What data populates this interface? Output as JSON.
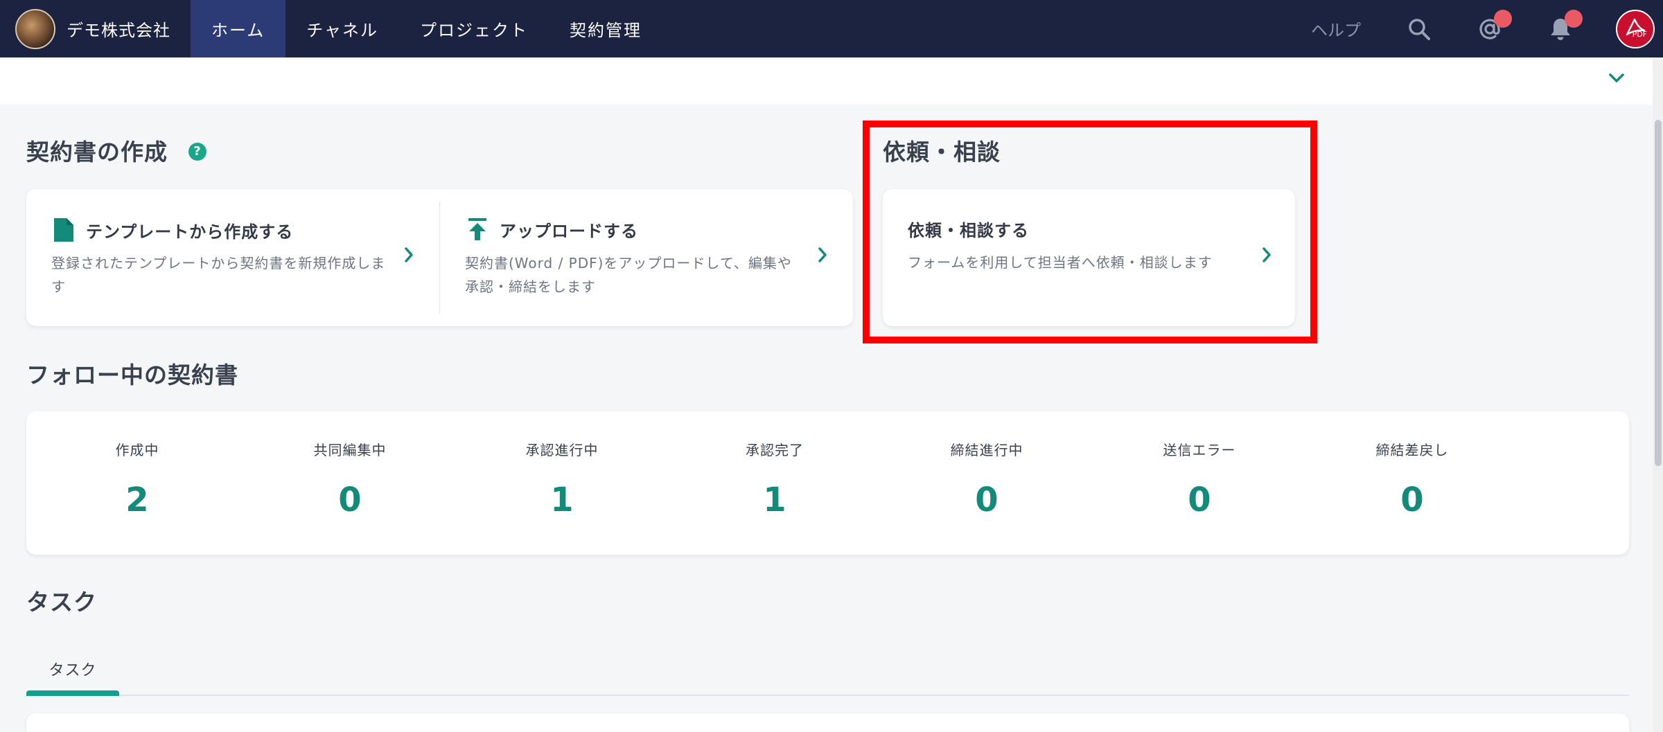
{
  "nav": {
    "company": "デモ株式会社",
    "tabs": [
      {
        "label": "ホーム",
        "active": true
      },
      {
        "label": "チャネル",
        "active": false
      },
      {
        "label": "プロジェクト",
        "active": false
      },
      {
        "label": "契約管理",
        "active": false
      }
    ],
    "help": "ヘルプ",
    "pdf_label": "PDF"
  },
  "create": {
    "title": "契約書の作成",
    "help_mark": "?",
    "options": [
      {
        "title": "テンプレートから作成する",
        "desc": "登録されたテンプレートから契約書を新規作成します"
      },
      {
        "title": "アップロードする",
        "desc": "契約書(Word / PDF)をアップロードして、編集や承認・締結をします"
      }
    ]
  },
  "consult": {
    "title": "依頼・相談",
    "card_title": "依頼・相談する",
    "card_desc": "フォームを利用して担当者へ依頼・相談します"
  },
  "following": {
    "title": "フォロー中の契約書",
    "statuses": [
      {
        "label": "作成中",
        "value": "2"
      },
      {
        "label": "共同編集中",
        "value": "0"
      },
      {
        "label": "承認進行中",
        "value": "1"
      },
      {
        "label": "承認完了",
        "value": "1"
      },
      {
        "label": "締結進行中",
        "value": "0"
      },
      {
        "label": "送信エラー",
        "value": "0"
      },
      {
        "label": "締結差戻し",
        "value": "0"
      }
    ]
  },
  "tasks": {
    "title": "タスク",
    "tab_label": "タスク"
  },
  "colors": {
    "nav_bg": "#1b2341",
    "nav_active": "#2c3a75",
    "accent": "#148a7a",
    "highlight": "#ff0000",
    "badge": "#e95a64"
  }
}
